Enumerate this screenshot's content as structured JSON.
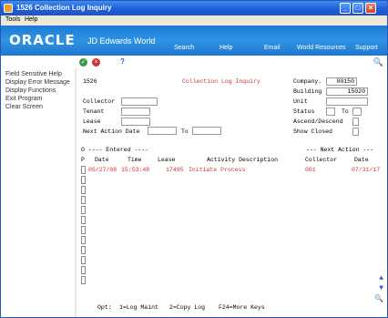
{
  "window": {
    "title": "1526  Collection Log Inquiry"
  },
  "menu": [
    "Tools",
    "Help"
  ],
  "banner": {
    "logo": "ORACLE",
    "logo_sub": "JD Edwards World",
    "nav": [
      "Search",
      "Help",
      "Email",
      "World Resources",
      "Support"
    ]
  },
  "toolbar": {
    "help_glyph": "?"
  },
  "left_menu": [
    "Field Sensitive Help",
    "Display Error Message",
    "Display Functions",
    "Exit Program",
    "Clear Screen"
  ],
  "form": {
    "program": "1526",
    "screen_title": "Collection Log Inquiry",
    "company_label": "Company.",
    "company_value": "00150",
    "building_label": "Building",
    "building_value": "15020",
    "unit_label": "Unit",
    "status_label": "Status",
    "to_label": "To",
    "ascend_label": "Ascend/Descend",
    "show_closed_label": "Show Closed",
    "collector_label": "Collector",
    "tenant_label": "Tenant",
    "lease_label": "Lease",
    "next_action_date_label": "Next Action Date",
    "next_to_label": "To"
  },
  "grid": {
    "group_entered": "O ---- Entered ----",
    "group_next_action": "--- Next Action ---",
    "headers": {
      "p": "P",
      "date": "Date",
      "time": "Time",
      "lease": "Lease",
      "activity": "Activity Description",
      "collector": "Collector",
      "date2": "Date"
    },
    "rows": [
      {
        "date": "05/27/08",
        "time": "15:53:48",
        "lease": "17495",
        "activity": "Initiate Process",
        "collector": "001",
        "next_date": "07/31/17"
      }
    ]
  },
  "footer": {
    "opt": "Opt:",
    "opt1": "1=Log Maint",
    "opt2": "2=Copy Log",
    "f24": "F24=More Keys"
  }
}
